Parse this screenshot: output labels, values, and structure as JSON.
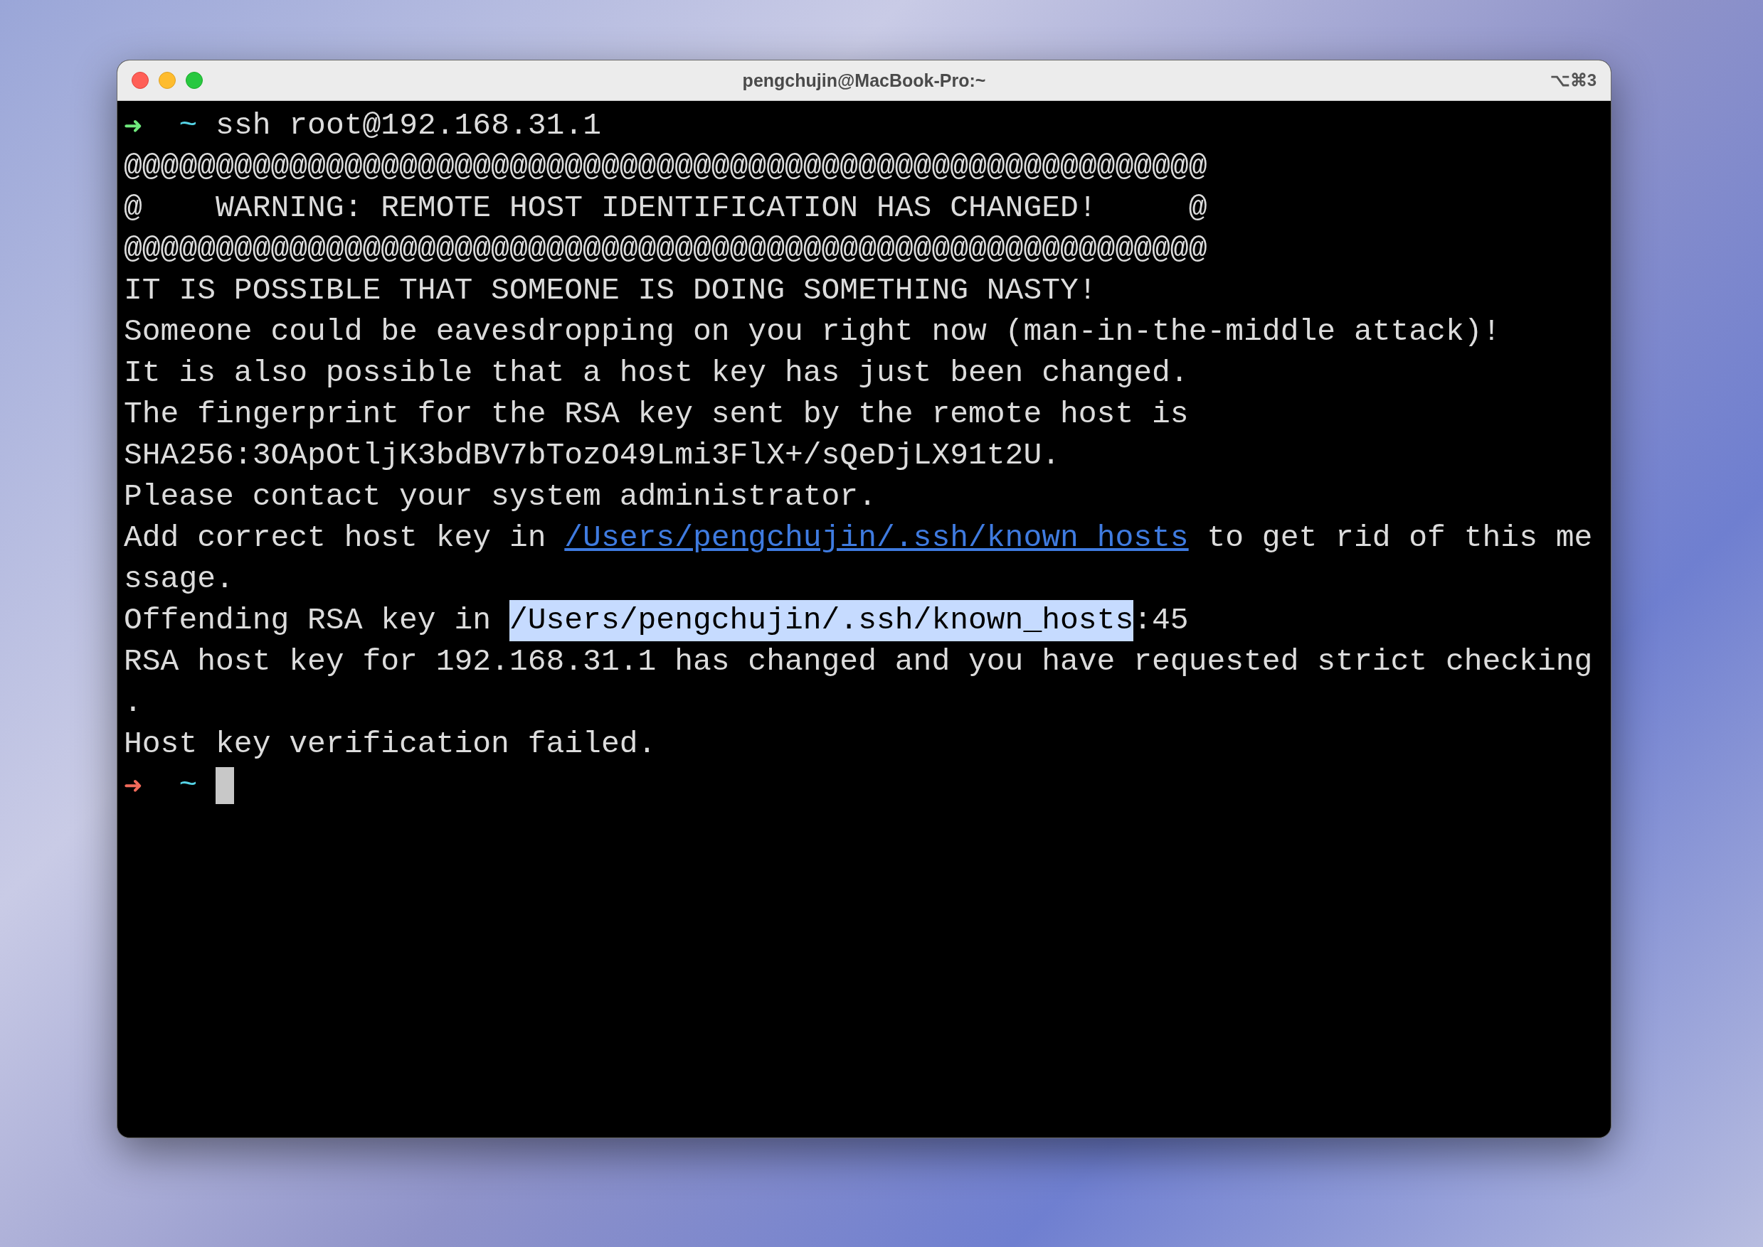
{
  "window": {
    "title": "pengchujin@MacBook-Pro:~",
    "shortcut": "⌥⌘3"
  },
  "lines": [
    {
      "kind": "prompt",
      "failed": false,
      "arrow": "➜",
      "dir": "~",
      "command": "ssh root@192.168.31.1",
      "cursor": false
    },
    {
      "kind": "output",
      "segments": [
        {
          "kind": "text",
          "text": "@@@@@@@@@@@@@@@@@@@@@@@@@@@@@@@@@@@@@@@@@@@@@@@@@@@@@@@@@@@"
        }
      ]
    },
    {
      "kind": "output",
      "segments": [
        {
          "kind": "text",
          "text": "@    WARNING: REMOTE HOST IDENTIFICATION HAS CHANGED!     @"
        }
      ]
    },
    {
      "kind": "output",
      "segments": [
        {
          "kind": "text",
          "text": "@@@@@@@@@@@@@@@@@@@@@@@@@@@@@@@@@@@@@@@@@@@@@@@@@@@@@@@@@@@"
        }
      ]
    },
    {
      "kind": "output",
      "segments": [
        {
          "kind": "text",
          "text": "IT IS POSSIBLE THAT SOMEONE IS DOING SOMETHING NASTY!"
        }
      ]
    },
    {
      "kind": "output",
      "segments": [
        {
          "kind": "text",
          "text": "Someone could be eavesdropping on you right now (man-in-the-middle attack)!"
        }
      ]
    },
    {
      "kind": "output",
      "segments": [
        {
          "kind": "text",
          "text": "It is also possible that a host key has just been changed."
        }
      ]
    },
    {
      "kind": "output",
      "segments": [
        {
          "kind": "text",
          "text": "The fingerprint for the RSA key sent by the remote host is"
        }
      ]
    },
    {
      "kind": "output",
      "segments": [
        {
          "kind": "text",
          "text": "SHA256:3OApOtljK3bdBV7bTozO49Lmi3FlX+/sQeDjLX91t2U."
        }
      ]
    },
    {
      "kind": "output",
      "segments": [
        {
          "kind": "text",
          "text": "Please contact your system administrator."
        }
      ]
    },
    {
      "kind": "output",
      "segments": [
        {
          "kind": "text",
          "text": "Add correct host key in "
        },
        {
          "kind": "link",
          "text": "/Users/pengchujin/.ssh/known_hosts"
        },
        {
          "kind": "text",
          "text": " to get rid of this me"
        }
      ]
    },
    {
      "kind": "output",
      "segments": [
        {
          "kind": "text",
          "text": "ssage."
        }
      ]
    },
    {
      "kind": "output",
      "segments": [
        {
          "kind": "text",
          "text": "Offending RSA key in "
        },
        {
          "kind": "selected",
          "text": "/Users/pengchujin/.ssh/known_hosts"
        },
        {
          "kind": "text",
          "text": ":45"
        }
      ]
    },
    {
      "kind": "output",
      "segments": [
        {
          "kind": "text",
          "text": "RSA host key for 192.168.31.1 has changed and you have requested strict checking"
        }
      ]
    },
    {
      "kind": "output",
      "segments": [
        {
          "kind": "text",
          "text": "."
        }
      ]
    },
    {
      "kind": "output",
      "segments": [
        {
          "kind": "text",
          "text": "Host key verification failed."
        }
      ]
    },
    {
      "kind": "prompt",
      "failed": true,
      "arrow": "➜",
      "dir": "~",
      "cursor": true
    }
  ]
}
